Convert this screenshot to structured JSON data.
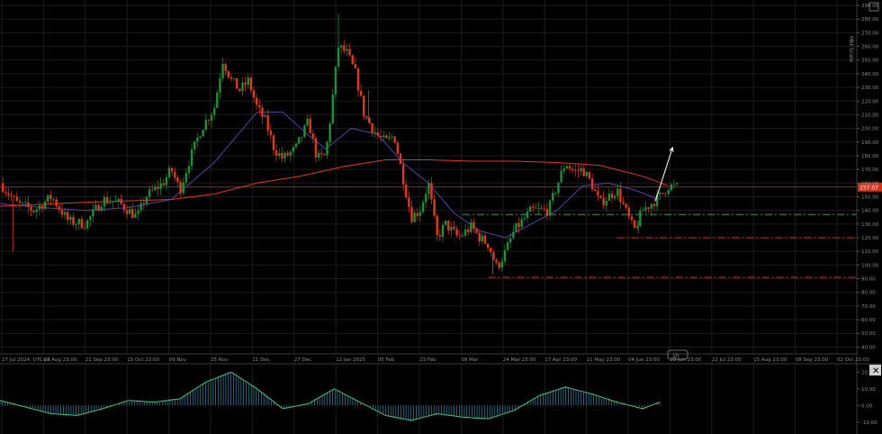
{
  "window": {
    "side_label": "Mkt Scale",
    "scale_badge": "1h"
  },
  "colors": {
    "background": "#000000",
    "grid": "#1c1c1c",
    "axis_text": "#8c8c8c",
    "candle_up": "#1f8f3a",
    "candle_down": "#e03a1e",
    "ma_fast": "#5a3fa8",
    "ma_slow": "#e8351f",
    "current_price_line": "#d03319",
    "support_green": "#2e9e4f",
    "support_red": "#e0341c",
    "forecast_arrow": "#ffffff",
    "osc_line": "#48c77a",
    "osc_hist": "#3a8ab0"
  },
  "chart_data": [
    {
      "type": "candlestick",
      "ylim": [
        35,
        292
      ],
      "y_ticks": [
        "290.00",
        "280.00",
        "270.00",
        "260.00",
        "250.00",
        "240.00",
        "230.00",
        "220.00",
        "210.00",
        "200.00",
        "190.00",
        "180.00",
        "170.00",
        "160.00",
        "150.00",
        "140.00",
        "130.00",
        "120.00",
        "110.00",
        "100.00",
        "90.00",
        "80.00",
        "70.00",
        "60.00",
        "50.00",
        "40.00"
      ],
      "x_tick_labels": [
        "27 Jul 2024, UTC+2",
        "28 Aug 23:00",
        "21 Sep 23:00",
        "15 Oct 23:00",
        "09 Nov",
        "25 Nov",
        "11 Dec",
        "27 Dec",
        "12 Jan 2025",
        "05 Feb",
        "23 Feb",
        "09 Mar",
        "24 Mar 23:00",
        "17 Apr 23:00",
        "11 May 23:00",
        "04 Jun 23:00",
        "28 Jun 23:00",
        "22 Jul 23:00",
        "15 Aug 23:00",
        "08 Sep 23:00",
        "02 Oct 23:00"
      ],
      "current_price": 157.07,
      "current_price_label": "157.07",
      "price_path": [
        {
          "t": 0.0,
          "p": 160
        },
        {
          "t": 0.02,
          "p": 145
        },
        {
          "t": 0.04,
          "p": 140
        },
        {
          "t": 0.06,
          "p": 150
        },
        {
          "t": 0.08,
          "p": 132
        },
        {
          "t": 0.1,
          "p": 130
        },
        {
          "t": 0.12,
          "p": 148
        },
        {
          "t": 0.14,
          "p": 145
        },
        {
          "t": 0.16,
          "p": 135
        },
        {
          "t": 0.17,
          "p": 150
        },
        {
          "t": 0.19,
          "p": 160
        },
        {
          "t": 0.2,
          "p": 170
        },
        {
          "t": 0.21,
          "p": 155
        },
        {
          "t": 0.22,
          "p": 175
        },
        {
          "t": 0.235,
          "p": 200
        },
        {
          "t": 0.25,
          "p": 215
        },
        {
          "t": 0.26,
          "p": 250
        },
        {
          "t": 0.27,
          "p": 235
        },
        {
          "t": 0.28,
          "p": 228
        },
        {
          "t": 0.29,
          "p": 235
        },
        {
          "t": 0.3,
          "p": 215
        },
        {
          "t": 0.31,
          "p": 205
        },
        {
          "t": 0.32,
          "p": 185
        },
        {
          "t": 0.33,
          "p": 178
        },
        {
          "t": 0.345,
          "p": 185
        },
        {
          "t": 0.36,
          "p": 205
        },
        {
          "t": 0.37,
          "p": 178
        },
        {
          "t": 0.38,
          "p": 180
        },
        {
          "t": 0.385,
          "p": 205
        },
        {
          "t": 0.395,
          "p": 260
        },
        {
          "t": 0.405,
          "p": 255
        },
        {
          "t": 0.415,
          "p": 240
        },
        {
          "t": 0.425,
          "p": 210
        },
        {
          "t": 0.44,
          "p": 195
        },
        {
          "t": 0.45,
          "p": 190
        },
        {
          "t": 0.46,
          "p": 195
        },
        {
          "t": 0.47,
          "p": 165
        },
        {
          "t": 0.48,
          "p": 135
        },
        {
          "t": 0.49,
          "p": 140
        },
        {
          "t": 0.5,
          "p": 160
        },
        {
          "t": 0.51,
          "p": 120
        },
        {
          "t": 0.52,
          "p": 130
        },
        {
          "t": 0.535,
          "p": 120
        },
        {
          "t": 0.55,
          "p": 128
        },
        {
          "t": 0.56,
          "p": 120
        },
        {
          "t": 0.57,
          "p": 115
        },
        {
          "t": 0.58,
          "p": 98
        },
        {
          "t": 0.59,
          "p": 110
        },
        {
          "t": 0.6,
          "p": 125
        },
        {
          "t": 0.62,
          "p": 140
        },
        {
          "t": 0.64,
          "p": 140
        },
        {
          "t": 0.65,
          "p": 158
        },
        {
          "t": 0.66,
          "p": 175
        },
        {
          "t": 0.67,
          "p": 168
        },
        {
          "t": 0.68,
          "p": 170
        },
        {
          "t": 0.69,
          "p": 160
        },
        {
          "t": 0.7,
          "p": 145
        },
        {
          "t": 0.71,
          "p": 150
        },
        {
          "t": 0.72,
          "p": 155
        },
        {
          "t": 0.73,
          "p": 140
        },
        {
          "t": 0.74,
          "p": 125
        },
        {
          "t": 0.75,
          "p": 140
        },
        {
          "t": 0.76,
          "p": 145
        },
        {
          "t": 0.77,
          "p": 150
        },
        {
          "t": 0.78,
          "p": 158
        },
        {
          "t": 0.79,
          "p": 157
        }
      ],
      "moving_averages": [
        {
          "name": "fast",
          "points": [
            {
              "t": 0.0,
              "p": 145
            },
            {
              "t": 0.05,
              "p": 142
            },
            {
              "t": 0.1,
              "p": 140
            },
            {
              "t": 0.15,
              "p": 142
            },
            {
              "t": 0.2,
              "p": 148
            },
            {
              "t": 0.25,
              "p": 175
            },
            {
              "t": 0.3,
              "p": 212
            },
            {
              "t": 0.33,
              "p": 212
            },
            {
              "t": 0.36,
              "p": 195
            },
            {
              "t": 0.38,
              "p": 185
            },
            {
              "t": 0.41,
              "p": 200
            },
            {
              "t": 0.44,
              "p": 196
            },
            {
              "t": 0.47,
              "p": 175
            },
            {
              "t": 0.5,
              "p": 160
            },
            {
              "t": 0.53,
              "p": 138
            },
            {
              "t": 0.56,
              "p": 125
            },
            {
              "t": 0.59,
              "p": 120
            },
            {
              "t": 0.62,
              "p": 130
            },
            {
              "t": 0.65,
              "p": 140
            },
            {
              "t": 0.68,
              "p": 158
            },
            {
              "t": 0.71,
              "p": 160
            },
            {
              "t": 0.74,
              "p": 155
            },
            {
              "t": 0.77,
              "p": 148
            }
          ]
        },
        {
          "name": "slow",
          "points": [
            {
              "t": 0.0,
              "p": 143
            },
            {
              "t": 0.1,
              "p": 146
            },
            {
              "t": 0.2,
              "p": 148
            },
            {
              "t": 0.25,
              "p": 152
            },
            {
              "t": 0.3,
              "p": 160
            },
            {
              "t": 0.35,
              "p": 165
            },
            {
              "t": 0.4,
              "p": 172
            },
            {
              "t": 0.45,
              "p": 177
            },
            {
              "t": 0.5,
              "p": 177
            },
            {
              "t": 0.55,
              "p": 176
            },
            {
              "t": 0.6,
              "p": 176
            },
            {
              "t": 0.65,
              "p": 175
            },
            {
              "t": 0.7,
              "p": 173
            },
            {
              "t": 0.75,
              "p": 165
            },
            {
              "t": 0.78,
              "p": 158
            }
          ]
        }
      ],
      "support_levels": [
        {
          "name": "green-support",
          "price": 137,
          "t_start": 0.54,
          "t_end": 1.0,
          "style": "dash-dot",
          "color_key": "support_green"
        },
        {
          "name": "red-support-1",
          "price": 120,
          "t_start": 0.72,
          "t_end": 1.0,
          "style": "dash-dot",
          "color_key": "support_red"
        },
        {
          "name": "red-support-2",
          "price": 91,
          "t_start": 0.57,
          "t_end": 1.0,
          "style": "dash-dot",
          "color_key": "support_red"
        }
      ],
      "forecast_arrow": {
        "t_from": 0.765,
        "p_from": 147,
        "t_to": 0.785,
        "p_to": 186
      }
    },
    {
      "type": "oscillator",
      "ylim": [
        -15,
        25
      ],
      "y_ticks": [
        "20.00",
        "10.00",
        "0.00",
        "-10.00"
      ],
      "points": [
        {
          "t": 0.0,
          "p": 3
        },
        {
          "t": 0.03,
          "p": -1
        },
        {
          "t": 0.06,
          "p": -5
        },
        {
          "t": 0.09,
          "p": -6
        },
        {
          "t": 0.12,
          "p": -2
        },
        {
          "t": 0.15,
          "p": 3
        },
        {
          "t": 0.18,
          "p": 2
        },
        {
          "t": 0.21,
          "p": 4
        },
        {
          "t": 0.24,
          "p": 14
        },
        {
          "t": 0.27,
          "p": 20
        },
        {
          "t": 0.3,
          "p": 10
        },
        {
          "t": 0.33,
          "p": -2
        },
        {
          "t": 0.36,
          "p": 1
        },
        {
          "t": 0.39,
          "p": 10
        },
        {
          "t": 0.42,
          "p": 2
        },
        {
          "t": 0.45,
          "p": -6
        },
        {
          "t": 0.48,
          "p": -9
        },
        {
          "t": 0.51,
          "p": -5
        },
        {
          "t": 0.54,
          "p": -7
        },
        {
          "t": 0.57,
          "p": -8
        },
        {
          "t": 0.6,
          "p": -3
        },
        {
          "t": 0.63,
          "p": 6
        },
        {
          "t": 0.66,
          "p": 11
        },
        {
          "t": 0.69,
          "p": 7
        },
        {
          "t": 0.72,
          "p": 2
        },
        {
          "t": 0.75,
          "p": -2
        },
        {
          "t": 0.77,
          "p": 2
        }
      ]
    }
  ]
}
